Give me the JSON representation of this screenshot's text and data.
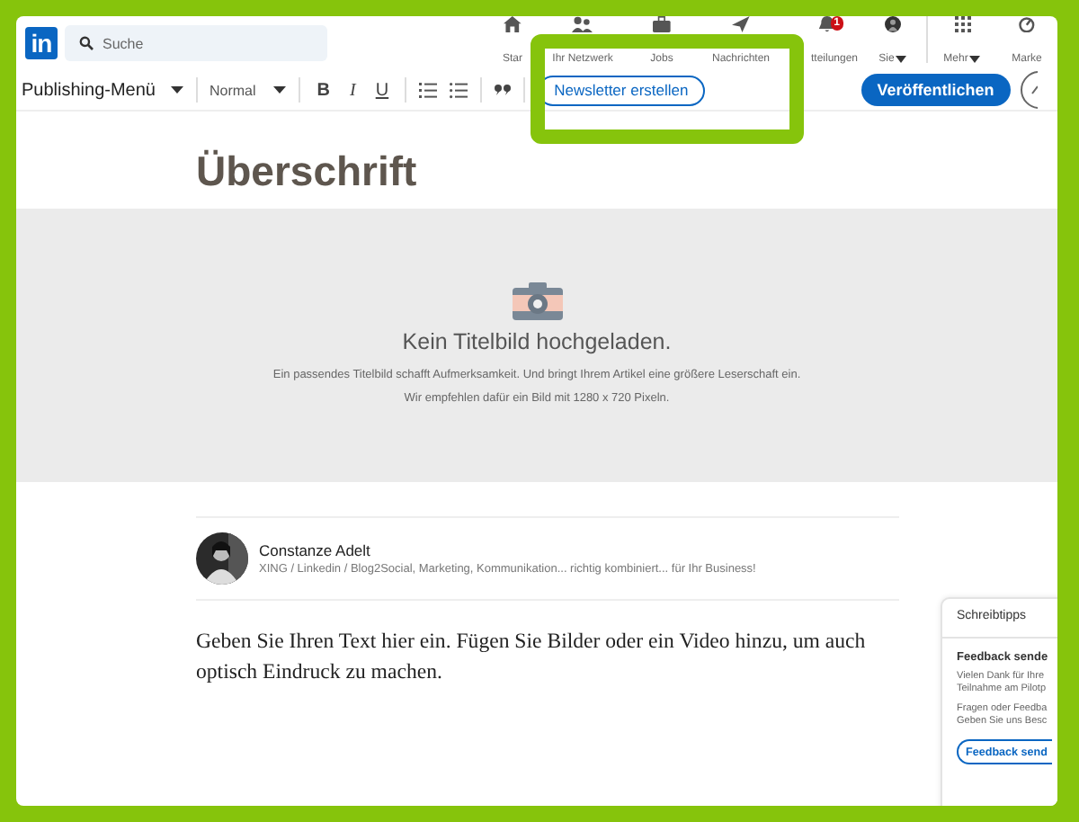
{
  "logo": "in",
  "search": {
    "placeholder": "Suche"
  },
  "nav": [
    {
      "label": "Star",
      "kind": "home"
    },
    {
      "label": "Ihr Netzwerk",
      "kind": "network"
    },
    {
      "label": "Jobs",
      "kind": "jobs"
    },
    {
      "label": "Nachrichten",
      "kind": "messages"
    },
    {
      "label": "tteilungen",
      "kind": "bell",
      "badge": "1"
    },
    {
      "label": "Sie",
      "kind": "avatar"
    },
    {
      "label": "Mehr",
      "kind": "grid"
    },
    {
      "label": "Marke",
      "kind": "marketing"
    }
  ],
  "toolbar": {
    "menu": "Publishing-Menü",
    "style": "Normal",
    "format": [
      "B",
      "I",
      "U"
    ],
    "newsletter_button": "Newsletter erstellen",
    "publish_button": "Veröffentlichen"
  },
  "title": "Überschrift",
  "cover": {
    "heading": "Kein Titelbild hochgeladen.",
    "lines": [
      "Ein passendes Titelbild schafft Aufmerksamkeit. Und bringt Ihrem Artikel eine größere Leserschaft ein.",
      "Wir empfehlen dafür ein Bild mit 1280 x 720 Pixeln."
    ]
  },
  "author": {
    "name": "Constanze Adelt",
    "tagline": "XING / Linkedin / Blog2Social, Marketing, Kommunikation... richtig kombiniert... für Ihr Business!"
  },
  "body": "Geben Sie Ihren Text hier ein. Fügen Sie Bilder oder ein Video hinzu, um auch optisch Eindruck zu machen.",
  "tips": {
    "title": "Schreibtipps",
    "heading": "Feedback sende",
    "lines": [
      "Vielen Dank für Ihre",
      "Teilnahme am Pilotp",
      "Fragen oder Feedba",
      "Geben Sie uns Besc"
    ],
    "button": "Feedback send"
  }
}
